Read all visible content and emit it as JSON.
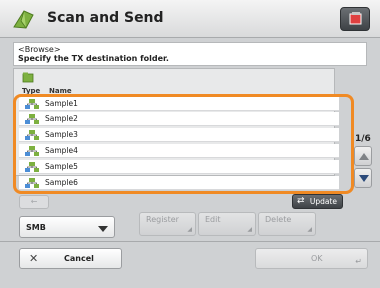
{
  "header": {
    "title": "Scan and Send",
    "icon": "scan-send-icon"
  },
  "instruction": {
    "line1": "<Browse>",
    "line2": "Specify the TX destination folder."
  },
  "list": {
    "columns": {
      "type": "Type",
      "name": "Name"
    },
    "rows": [
      {
        "label": "Sample1",
        "icon": "network-folder-icon"
      },
      {
        "label": "Sample2",
        "icon": "network-folder-icon"
      },
      {
        "label": "Sample3",
        "icon": "network-folder-icon"
      },
      {
        "label": "Sample4",
        "icon": "network-folder-icon"
      },
      {
        "label": "Sample5",
        "icon": "network-folder-icon"
      },
      {
        "label": "Sample6",
        "icon": "network-folder-icon"
      }
    ],
    "highlight_color": "#f08a24"
  },
  "pagination": {
    "indicator": "1/6"
  },
  "buttons": {
    "update": "Update",
    "protocol": "SMB",
    "register": "Register",
    "edit": "Edit",
    "delete": "Delete",
    "cancel": "Cancel",
    "ok": "OK"
  }
}
